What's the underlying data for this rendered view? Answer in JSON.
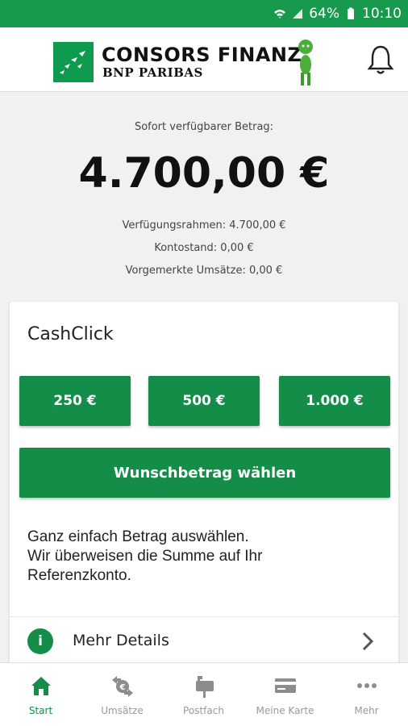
{
  "status_bar": {
    "battery": "64%",
    "time": "10:10",
    "icons": [
      "wifi-icon",
      "signal-icon",
      "battery-icon"
    ]
  },
  "header": {
    "brand_name": "CONSORS FINANZ",
    "brand_sub": "BNP PARIBAS",
    "icons": [
      "logo-icon",
      "mascot-icon",
      "bell-icon"
    ]
  },
  "balance": {
    "label": "Sofort verfügbarer Betrag:",
    "amount": "4.700,00 €",
    "details": [
      "Verfügungsrahmen: 4.700,00 €",
      "Kontostand: 0,00 €",
      "Vorgemerkte Umsätze: 0,00 €"
    ]
  },
  "cashclick": {
    "title": "CashClick",
    "amounts": [
      "250 €",
      "500 €",
      "1.000 €"
    ],
    "wish_button": "Wunschbetrag wählen",
    "description_lines": [
      "Ganz einfach Betrag auswählen.",
      "Wir überweisen die Summe auf Ihr",
      "Referenzkonto."
    ],
    "details_label": "Mehr Details"
  },
  "nav": {
    "items": [
      {
        "label": "Start",
        "icon": "home-icon",
        "active": true
      },
      {
        "label": "Umsätze",
        "icon": "transactions-icon",
        "active": false
      },
      {
        "label": "Postfach",
        "icon": "mailbox-icon",
        "active": false
      },
      {
        "label": "Meine Karte",
        "icon": "card-icon",
        "active": false
      },
      {
        "label": "Mehr",
        "icon": "more-icon",
        "active": false
      }
    ]
  },
  "colors": {
    "primary": "#138d48",
    "status_bar": "#189a4e",
    "background": "#f1f1f1",
    "inactive": "#999999"
  }
}
